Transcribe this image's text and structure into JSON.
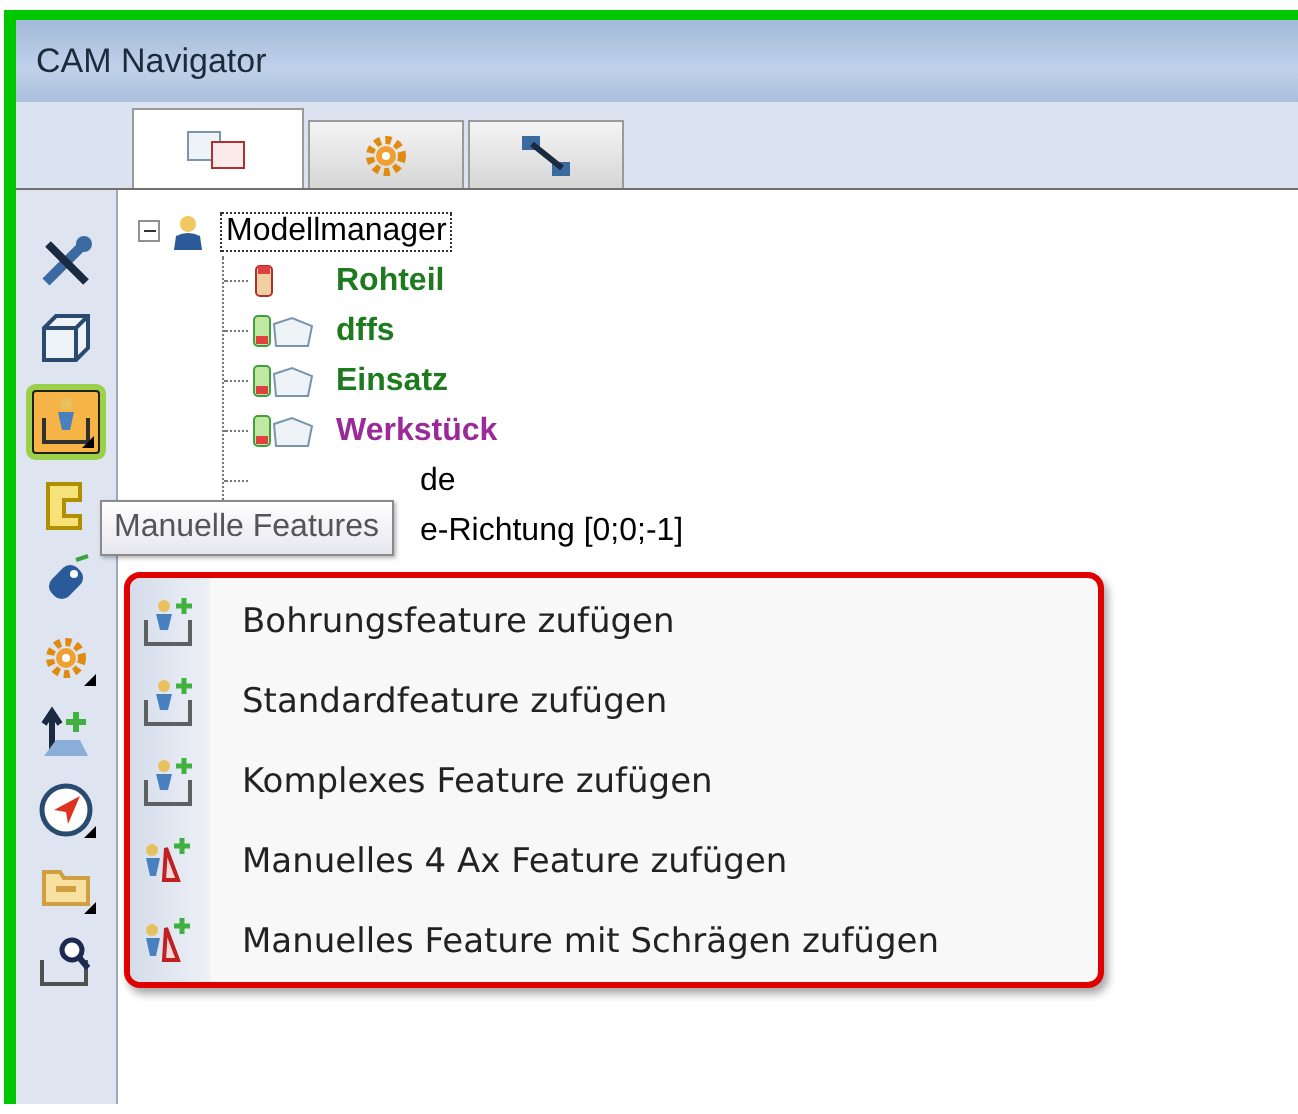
{
  "window": {
    "title": "CAM Navigator"
  },
  "tabs": [
    {
      "kind": "cubes",
      "selected": true
    },
    {
      "kind": "gear",
      "selected": false
    },
    {
      "kind": "link",
      "selected": false
    }
  ],
  "toolbar": [
    {
      "kind": "tools",
      "selected": false,
      "has_menu": false
    },
    {
      "kind": "cube",
      "selected": false,
      "has_menu": false
    },
    {
      "kind": "pocket",
      "selected": true,
      "has_menu": true
    },
    {
      "kind": "bracket",
      "selected": false,
      "has_menu": false
    },
    {
      "kind": "probe",
      "selected": false,
      "has_menu": false
    },
    {
      "kind": "gear",
      "selected": false,
      "has_menu": true
    },
    {
      "kind": "axis",
      "selected": false,
      "has_menu": false
    },
    {
      "kind": "compass",
      "selected": false,
      "has_menu": true
    },
    {
      "kind": "folder",
      "selected": false,
      "has_menu": true
    },
    {
      "kind": "inspect",
      "selected": false,
      "has_menu": false
    }
  ],
  "tree": [
    {
      "label": "Modellmanager",
      "expanded": true,
      "focused": true,
      "children": [
        {
          "label": "Rohteil",
          "kind": "stock",
          "color": "#1e7a1e"
        },
        {
          "label": "dffs",
          "kind": "part",
          "color": "#1e7a1e"
        },
        {
          "label": "Einsatz",
          "kind": "part",
          "color": "#1e7a1e"
        },
        {
          "label": "Werkstück",
          "kind": "part",
          "color": "#9a2a9a"
        },
        {
          "label": "de",
          "kind": "covered",
          "color": "#000000"
        },
        {
          "label": "e-Richtung [0;0;-1]",
          "kind": "covered",
          "color": "#000000"
        }
      ]
    }
  ],
  "tooltip": "Manuelle Features",
  "context_menu": [
    {
      "label": "Bohrungsfeature zufügen",
      "kind": "pocket"
    },
    {
      "label": "Standardfeature zufügen",
      "kind": "pocket"
    },
    {
      "label": "Komplexes Feature zufügen",
      "kind": "pocket"
    },
    {
      "label": "Manuelles 4 Ax Feature zufügen",
      "kind": "wedge"
    },
    {
      "label": "Manuelles Feature mit Schrägen zufügen",
      "kind": "wedge"
    }
  ]
}
